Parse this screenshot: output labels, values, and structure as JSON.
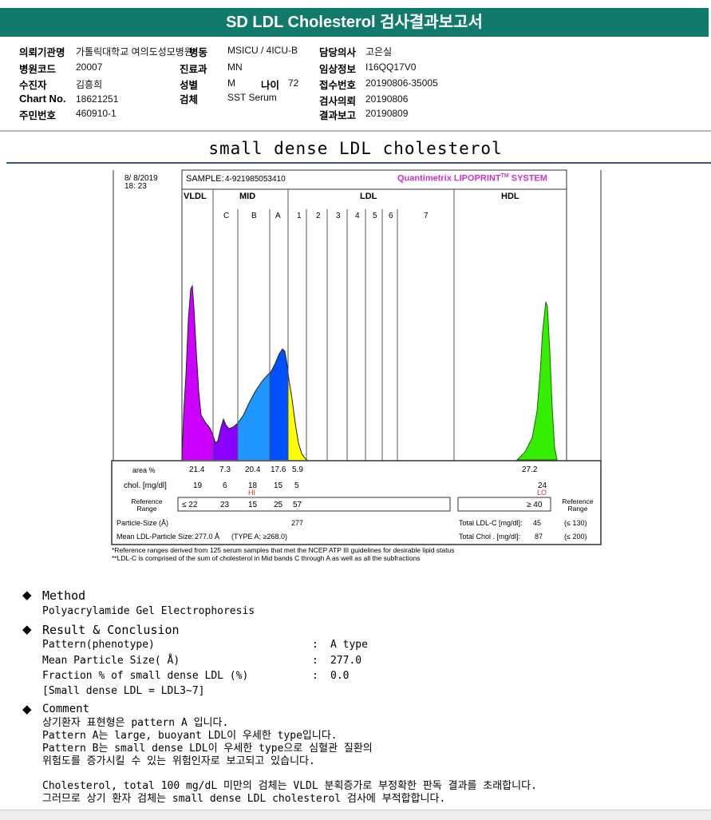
{
  "title": "SD LDL Cholesterol 검사결과보고서",
  "info": {
    "hospital_label": "의뢰기관명",
    "hospital": "가톨릭대학교 여의도성모병원",
    "ward_label": "병동",
    "ward": "MSICU / 4ICU-B",
    "doctor_label": "담당의사",
    "doctor": "고은실",
    "code_label": "병원코드",
    "code": "20007",
    "dept_label": "진료과",
    "dept": "MN",
    "clinical_label": "임상정보",
    "clinical": "I16QQ17V0",
    "patient_label": "수진자",
    "patient": "김흥희",
    "sex_label": "성별",
    "sex": "M",
    "age_label": "나이",
    "age": "72",
    "receipt_label": "접수번호",
    "receipt": "20190806-35005",
    "chart_label": "Chart No.",
    "chart": "18621251",
    "specimen_label": "검체",
    "specimen": "SST Serum",
    "request_label": "검사의뢰",
    "request": "20190806",
    "id_label": "주민번호",
    "id": "460910-1",
    "report_label": "결과보고",
    "report": "20190809"
  },
  "subtitle": "small dense LDL cholesterol",
  "chart_data": {
    "type": "area",
    "date": "8/ 8/2019",
    "time": "18: 23",
    "sample_label": "SAMPLE:",
    "sample": "4-921985053410",
    "brand": "Quantimetrix LIPOPRINT",
    "brand_tm": "TM",
    "brand_suffix": " SYSTEM",
    "groups": [
      "VLDL",
      "MID",
      "LDL",
      "HDL"
    ],
    "subbands": [
      "C",
      "B",
      "A",
      "1",
      "2",
      "3",
      "4",
      "5",
      "6",
      "7"
    ],
    "colors": {
      "VLDL": "#cc00ff",
      "C": "#8a00ff",
      "B": "#1e98ff",
      "A": "#0050ff",
      "LDL1": "#ffff00",
      "HDL": "#33ee00"
    },
    "rows": {
      "area_label": "area %",
      "area": [
        "21.4",
        "7.3",
        "20.4",
        "17.6",
        "5.9"
      ],
      "area_hdl": "27.2",
      "chol_label": "chol. [mg/dl]",
      "chol": [
        "19",
        "6",
        "18",
        "15",
        "5"
      ],
      "chol_hdl": "24",
      "flag_b": "HI",
      "flag_hdl": "LO",
      "ref_label": "Reference Range",
      "ref": [
        "≤ 22",
        "23",
        "15",
        "25",
        "57"
      ],
      "ref_hdl": "≥ 40",
      "ref_label_right": "Reference Range",
      "size_label": "Particle-Size (Å)",
      "size": "277",
      "mean_label": "Mean LDL-Particle Size:",
      "mean": "277.0 Å",
      "mean_type": "(TYPE A; ≥268.0)",
      "ldlc_label": "Total LDL-C [mg/dl]:",
      "ldlc": "45",
      "ldlc_ref": "(≤ 130)",
      "tchol_label": "Total Chol . [mg/dl]:",
      "tchol": "87",
      "tchol_ref": "(≤ 200)"
    },
    "footnote1": "*Reference ranges derived from 125 serum samples that met the NCEP ATP III guidelines for desirable lipid status",
    "footnote2": "**LDL-C is comprised of the sum of cholesterol in Mid bands C through A as well as all the subfractions"
  },
  "method": {
    "heading": "Method",
    "text": "Polyacrylamide Gel Electrophoresis"
  },
  "result": {
    "heading": "Result & Conclusion",
    "items": [
      {
        "label": "Pattern(phenotype)",
        "value": "A type"
      },
      {
        "label": "Mean Particle Size( Å)",
        "value": "277.0"
      },
      {
        "label": "Fraction % of small dense LDL (%)",
        "value": "0.0"
      }
    ],
    "note": "[Small dense LDL = LDL3~7]",
    "sep": ":"
  },
  "comment": {
    "heading": "Comment",
    "lines": [
      "상기환자 표현형은 pattern A 입니다.",
      "Pattern A는 large, buoyant LDL이 우세한 type입니다.",
      "Pattern B는 small dense LDL이 우세한 type으로 심혈관 질환의",
      "위험도를 증가시킬 수 있는 위험인자로 보고되고 있습니다.",
      "Cholesterol, total 100 mg/dL 미만의 검체는 VLDL 분획증가로 부정확한 판독 결과를 초래합니다.",
      "그러므로 상기 환자 검체는 small dense LDL cholesterol 검사에 부적합합니다."
    ]
  }
}
